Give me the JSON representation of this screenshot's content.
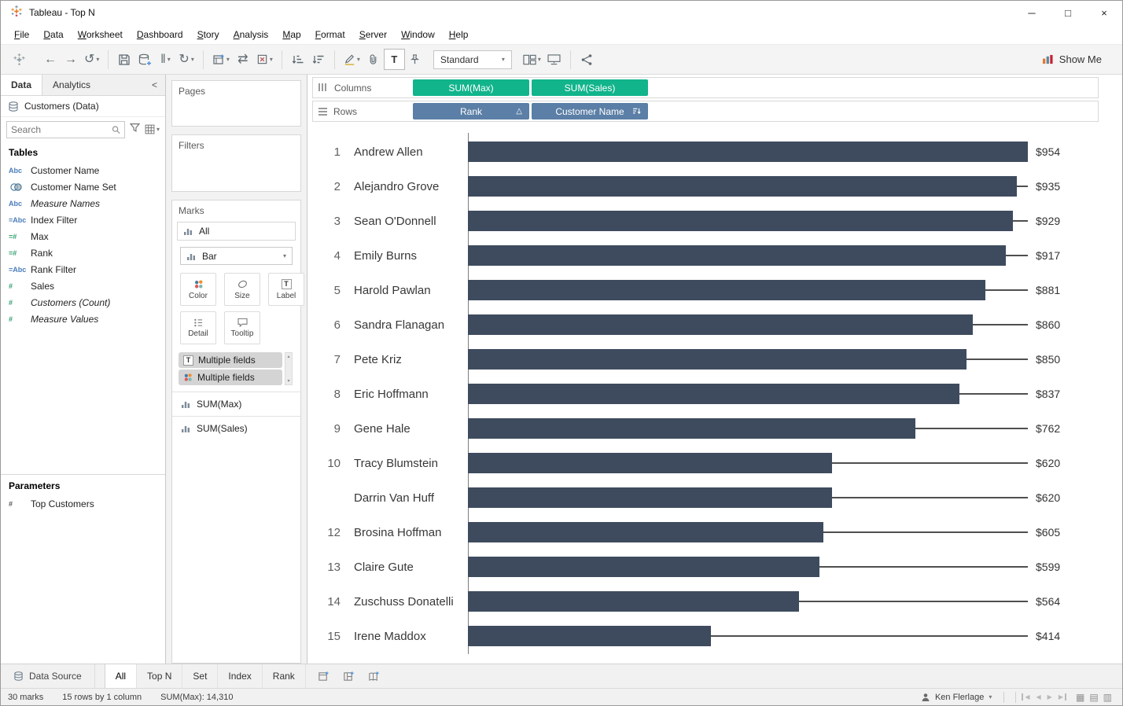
{
  "window": {
    "title": "Tableau - Top N"
  },
  "icons": {
    "caret_down": "▾",
    "caret_up": "▴",
    "undo": "←",
    "redo": "→",
    "replay": "↺",
    "refresh": "↻",
    "pause": "‖",
    "swap": "⇄",
    "chevron_left": "<",
    "minimize": "─",
    "maximize": "□",
    "close": "×",
    "delta": "△",
    "label_t": "T",
    "nav_prev": "◀",
    "nav_next": "▶",
    "grid_a": "▦",
    "grid_b": "▤",
    "grid_c": "▥"
  },
  "menu": {
    "items": [
      "File",
      "Data",
      "Worksheet",
      "Dashboard",
      "Story",
      "Analysis",
      "Map",
      "Format",
      "Server",
      "Window",
      "Help"
    ]
  },
  "toolbar": {
    "fit": "Standard",
    "show_me": "Show Me"
  },
  "left_panel": {
    "tab_data": "Data",
    "tab_analytics": "Analytics",
    "datasource": "Customers (Data)",
    "search_placeholder": "Search",
    "tables_header": "Tables",
    "fields": [
      {
        "icon": "Abc",
        "kind": "dimension",
        "label": "Customer Name"
      },
      {
        "icon": "set",
        "kind": "set",
        "label": "Customer Name Set"
      },
      {
        "icon": "Abc",
        "kind": "dimension",
        "label": "Measure Names",
        "italic": true
      },
      {
        "icon": "=Abc",
        "kind": "dimension",
        "label": "Index Filter"
      },
      {
        "icon": "=#",
        "kind": "measure",
        "label": "Max"
      },
      {
        "icon": "=#",
        "kind": "measure",
        "label": "Rank"
      },
      {
        "icon": "=Abc",
        "kind": "dimension",
        "label": "Rank Filter"
      },
      {
        "icon": "#",
        "kind": "measure",
        "label": "Sales"
      },
      {
        "icon": "#",
        "kind": "measure",
        "label": "Customers (Count)",
        "italic": true
      },
      {
        "icon": "#",
        "kind": "measure",
        "label": "Measure Values",
        "italic": true
      }
    ],
    "parameters_header": "Parameters",
    "parameters": [
      {
        "icon": "#",
        "kind": "parameter",
        "label": "Top Customers"
      }
    ]
  },
  "cards": {
    "pages_label": "Pages",
    "filters_label": "Filters",
    "marks_label": "Marks",
    "marks_all_label": "All",
    "mark_type": "Bar",
    "buttons": [
      {
        "id": "color",
        "label": "Color"
      },
      {
        "id": "size",
        "label": "Size"
      },
      {
        "id": "label",
        "label": "Label"
      },
      {
        "id": "detail",
        "label": "Detail"
      },
      {
        "id": "tooltip",
        "label": "Tooltip"
      }
    ],
    "field_pills": [
      {
        "icon": "label-icon",
        "label": "Multiple fields"
      },
      {
        "icon": "color-icon",
        "label": "Multiple fields"
      }
    ],
    "mark_sections": [
      "SUM(Max)",
      "SUM(Sales)"
    ]
  },
  "shelves": {
    "columns_label": "Columns",
    "rows_label": "Rows",
    "columns_pills": [
      {
        "label": "SUM(Max)",
        "color": "green"
      },
      {
        "label": "SUM(Sales)",
        "color": "green"
      }
    ],
    "rows_pills": [
      {
        "label": "Rank",
        "color": "blue",
        "badge": "delta"
      },
      {
        "label": "Customer Name",
        "color": "blue",
        "badge": "sort"
      }
    ]
  },
  "chart_data": {
    "type": "bar",
    "orientation": "horizontal",
    "axis_max": 954,
    "bar_color": "#3e4b5e",
    "line_color": "#4f4f4f",
    "rows": [
      {
        "rank": "1",
        "name": "Andrew Allen",
        "value": 954,
        "label": "$954"
      },
      {
        "rank": "2",
        "name": "Alejandro Grove",
        "value": 935,
        "label": "$935"
      },
      {
        "rank": "3",
        "name": "Sean O'Donnell",
        "value": 929,
        "label": "$929"
      },
      {
        "rank": "4",
        "name": "Emily Burns",
        "value": 917,
        "label": "$917"
      },
      {
        "rank": "5",
        "name": "Harold Pawlan",
        "value": 881,
        "label": "$881"
      },
      {
        "rank": "6",
        "name": "Sandra Flanagan",
        "value": 860,
        "label": "$860"
      },
      {
        "rank": "7",
        "name": "Pete Kriz",
        "value": 850,
        "label": "$850"
      },
      {
        "rank": "8",
        "name": "Eric Hoffmann",
        "value": 837,
        "label": "$837"
      },
      {
        "rank": "9",
        "name": "Gene Hale",
        "value": 762,
        "label": "$762"
      },
      {
        "rank": "10",
        "name": "Tracy Blumstein",
        "value": 620,
        "label": "$620"
      },
      {
        "rank": "",
        "name": "Darrin Van Huff",
        "value": 620,
        "label": "$620"
      },
      {
        "rank": "12",
        "name": "Brosina Hoffman",
        "value": 605,
        "label": "$605"
      },
      {
        "rank": "13",
        "name": "Claire Gute",
        "value": 599,
        "label": "$599"
      },
      {
        "rank": "14",
        "name": "Zuschuss Donatelli",
        "value": 564,
        "label": "$564"
      },
      {
        "rank": "15",
        "name": "Irene Maddox",
        "value": 414,
        "label": "$414"
      }
    ]
  },
  "sheet_tabs": {
    "datasource_tab": "Data Source",
    "tabs": [
      "All",
      "Top N",
      "Set",
      "Index",
      "Rank"
    ],
    "active": "All"
  },
  "status_bar": {
    "marks": "30 marks",
    "size": "15 rows by 1 column",
    "aggregate": "SUM(Max): 14,310",
    "user": "Ken Flerlage"
  }
}
